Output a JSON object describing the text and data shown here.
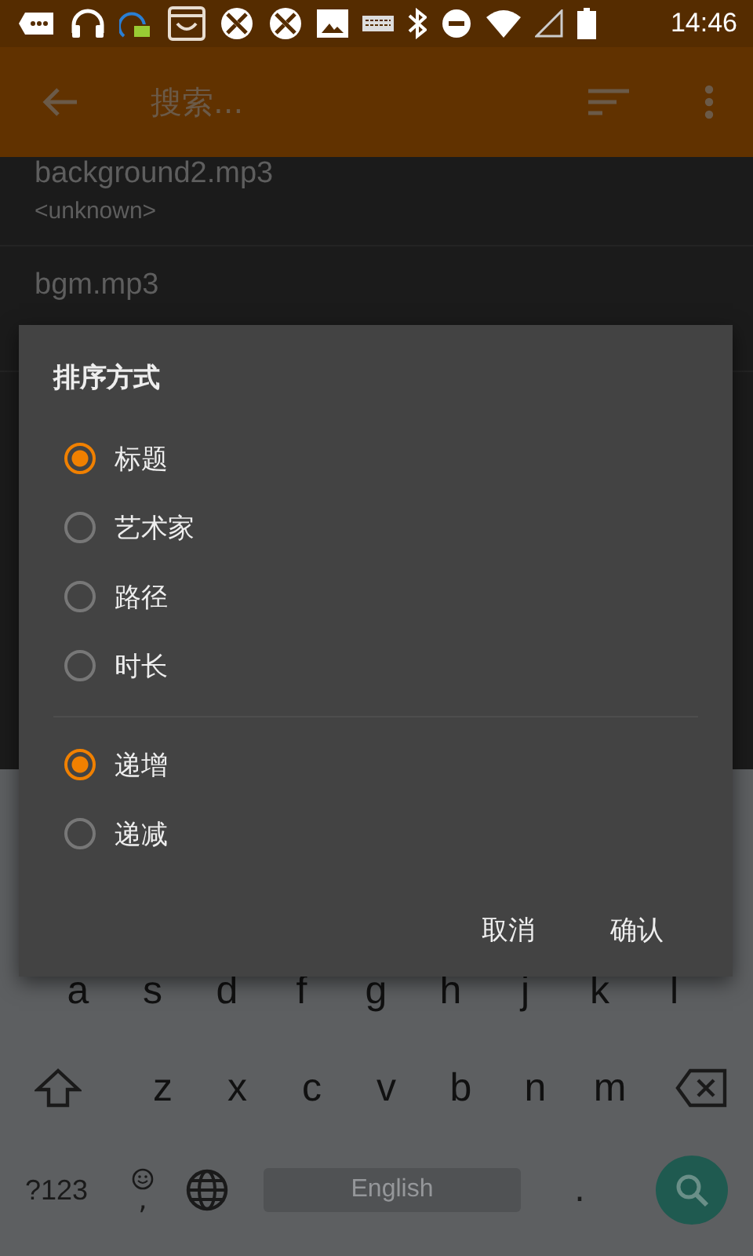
{
  "status_bar": {
    "time": "14:46"
  },
  "app_bar": {
    "search": {
      "placeholder": "搜索..."
    }
  },
  "list": [
    {
      "title": "background2.mp3",
      "subtitle": "<unknown>"
    },
    {
      "title": "bgm.mp3"
    }
  ],
  "dialog": {
    "title": "排序方式",
    "sort_fields": [
      {
        "label": "标题",
        "selected": true
      },
      {
        "label": "艺术家",
        "selected": false
      },
      {
        "label": "路径",
        "selected": false
      },
      {
        "label": "时长",
        "selected": false
      }
    ],
    "sort_orders": [
      {
        "label": "递增",
        "selected": true
      },
      {
        "label": "递减",
        "selected": false
      }
    ],
    "buttons": [
      "取消",
      "确认"
    ]
  },
  "keyboard": {
    "home_row_keys": [
      "a",
      "s",
      "d",
      "f",
      "g",
      "h",
      "j",
      "k",
      "l"
    ],
    "lower_row_keys": [
      "z",
      "x",
      "c",
      "v",
      "b",
      "n",
      "m"
    ],
    "symbols_key": "?123",
    "comma_key": ",",
    "space_key": "English",
    "period_key": "."
  }
}
